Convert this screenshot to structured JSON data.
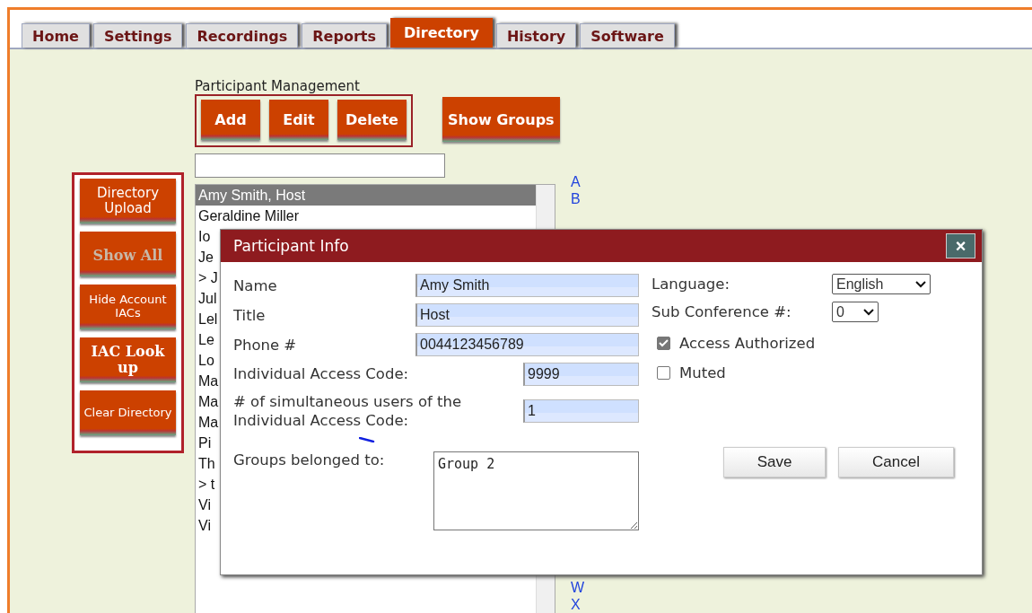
{
  "tabs": [
    {
      "label": "Home",
      "selected": false
    },
    {
      "label": "Settings",
      "selected": false
    },
    {
      "label": "Recordings",
      "selected": false
    },
    {
      "label": "Reports",
      "selected": false
    },
    {
      "label": "Directory",
      "selected": true
    },
    {
      "label": "History",
      "selected": false
    },
    {
      "label": "Software",
      "selected": false
    }
  ],
  "section_title": "Participant Management",
  "management_buttons": [
    "Add",
    "Edit",
    "Delete"
  ],
  "show_groups_button": "Show Groups",
  "side_buttons": [
    {
      "label": "Directory Upload",
      "disabled": false,
      "kind": "plain"
    },
    {
      "label": "Show All",
      "disabled": true,
      "kind": "heavy"
    },
    {
      "label": "Hide Account IACs",
      "disabled": false,
      "kind": "compact"
    },
    {
      "label": "IAC Look up",
      "disabled": false,
      "kind": "heavy"
    },
    {
      "label": "Clear Directory",
      "disabled": false,
      "kind": "compact"
    }
  ],
  "participants": [
    {
      "name": "Amy Smith, Host",
      "selected": true
    },
    {
      "name": "Geraldine Miller",
      "selected": false
    },
    {
      "name": "Io",
      "selected": false
    },
    {
      "name": "Je",
      "selected": false
    },
    {
      "name": "> J",
      "selected": false
    },
    {
      "name": "Jul",
      "selected": false
    },
    {
      "name": "Lel",
      "selected": false
    },
    {
      "name": "Le",
      "selected": false
    },
    {
      "name": "Lo",
      "selected": false
    },
    {
      "name": "Ma",
      "selected": false
    },
    {
      "name": "Ma",
      "selected": false
    },
    {
      "name": "Ma",
      "selected": false
    },
    {
      "name": "Pi",
      "selected": false
    },
    {
      "name": "Th",
      "selected": false
    },
    {
      "name": "> t",
      "selected": false
    },
    {
      "name": "Vi",
      "selected": false
    },
    {
      "name": "Vi",
      "selected": false
    }
  ],
  "index_top": [
    "A",
    "B"
  ],
  "index_bottom": [
    "W",
    "X"
  ],
  "dialog": {
    "title": "Participant Info",
    "close": "×",
    "fields": [
      {
        "label": "Name",
        "value": "Amy Smith",
        "kind": "wide"
      },
      {
        "label": "Title",
        "value": "Host",
        "kind": "wide"
      },
      {
        "label": "Phone #",
        "value": "0044123456789",
        "kind": "wide"
      },
      {
        "label": "Individual Access Code:",
        "value": "9999",
        "kind": "narrow"
      },
      {
        "label": "# of simultaneous users of the Individual Access Code:",
        "value": "1",
        "kind": "narrow"
      }
    ],
    "groups_label": "Groups belonged to:",
    "groups_value": "Group 2",
    "selects": [
      {
        "label": "Language:",
        "value": "English",
        "kind": "wide"
      },
      {
        "label": "Sub Conference #:",
        "value": "0",
        "kind": "narrow"
      }
    ],
    "checkboxes": [
      {
        "label": "Access Authorized",
        "checked": true
      },
      {
        "label": "Muted",
        "checked": false
      }
    ],
    "buttons": [
      "Save",
      "Cancel"
    ]
  }
}
